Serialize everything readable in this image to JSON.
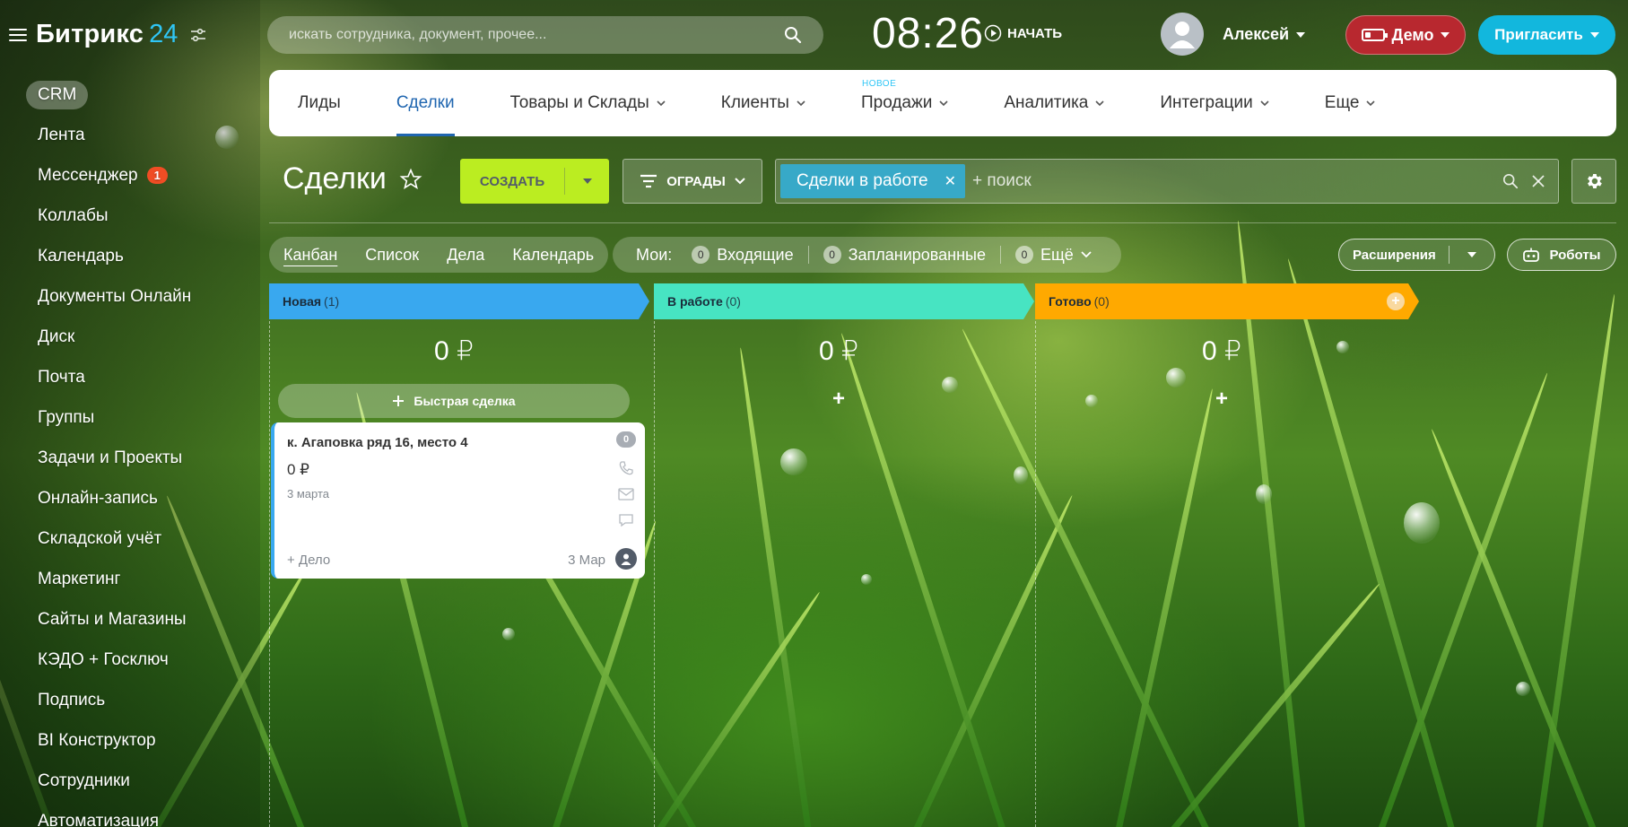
{
  "brand": {
    "name": "Битрикс",
    "num": "24"
  },
  "sidebar": {
    "items": [
      {
        "label": "CRM",
        "active": true
      },
      {
        "label": "Лента"
      },
      {
        "label": "Мессенджер",
        "badge": "1"
      },
      {
        "label": "Коллабы"
      },
      {
        "label": "Календарь"
      },
      {
        "label": "Документы Онлайн"
      },
      {
        "label": "Диск"
      },
      {
        "label": "Почта"
      },
      {
        "label": "Группы"
      },
      {
        "label": "Задачи и Проекты"
      },
      {
        "label": "Онлайн-запись"
      },
      {
        "label": "Складской учёт"
      },
      {
        "label": "Маркетинг"
      },
      {
        "label": "Сайты и Магазины"
      },
      {
        "label": "КЭДО + Госключ"
      },
      {
        "label": "Подпись"
      },
      {
        "label": "BI Конструктор"
      },
      {
        "label": "Сотрудники"
      },
      {
        "label": "Автоматизация"
      }
    ]
  },
  "topbar": {
    "search_placeholder": "искать сотрудника, документ, прочее...",
    "clock": "08:26",
    "start_label": "НАЧАТЬ",
    "user_name": "Алексей",
    "demo_label": "Демо",
    "invite_label": "Пригласить"
  },
  "tabs": [
    {
      "label": "Лиды"
    },
    {
      "label": "Сделки",
      "active": true
    },
    {
      "label": "Товары и Склады",
      "dropdown": true
    },
    {
      "label": "Клиенты",
      "dropdown": true
    },
    {
      "label": "Продажи",
      "dropdown": true,
      "new_badge": "НОВОЕ"
    },
    {
      "label": "Аналитика",
      "dropdown": true
    },
    {
      "label": "Интеграции",
      "dropdown": true
    },
    {
      "label": "Еще",
      "dropdown": true
    }
  ],
  "toolbar": {
    "title": "Сделки",
    "create_label": "СОЗДАТЬ",
    "filter_label": "ОГРАДЫ",
    "filter_chip": "Сделки в работе",
    "filter_search_placeholder": "+ поиск"
  },
  "views": {
    "items": [
      "Канбан",
      "Список",
      "Дела",
      "Календарь"
    ],
    "active": "Канбан"
  },
  "counters": {
    "mine_label": "Мои:",
    "items": [
      {
        "count": "0",
        "label": "Входящие"
      },
      {
        "count": "0",
        "label": "Запланированные"
      },
      {
        "count": "0",
        "label": "Ещё"
      }
    ]
  },
  "extensions_label": "Расширения",
  "robots_label": "Роботы",
  "columns": [
    {
      "title": "Новая",
      "count": "(1)",
      "sum": "0 ₽",
      "color": "#39a8ef",
      "quick_deal": "Быстрая сделка"
    },
    {
      "title": "В работе",
      "count": "(0)",
      "sum": "0 ₽",
      "color": "#47e4c2",
      "plus": "+"
    },
    {
      "title": "Готово",
      "count": "(0)",
      "sum": "0 ₽",
      "color": "#ffa900",
      "plus": "+"
    }
  ],
  "card": {
    "title": "к. Агаповка ряд 16, место 4",
    "sum": "0 ₽",
    "date": "3 марта",
    "counter": "0",
    "add_activity": "+ Дело",
    "deadline": "3 Мар"
  }
}
